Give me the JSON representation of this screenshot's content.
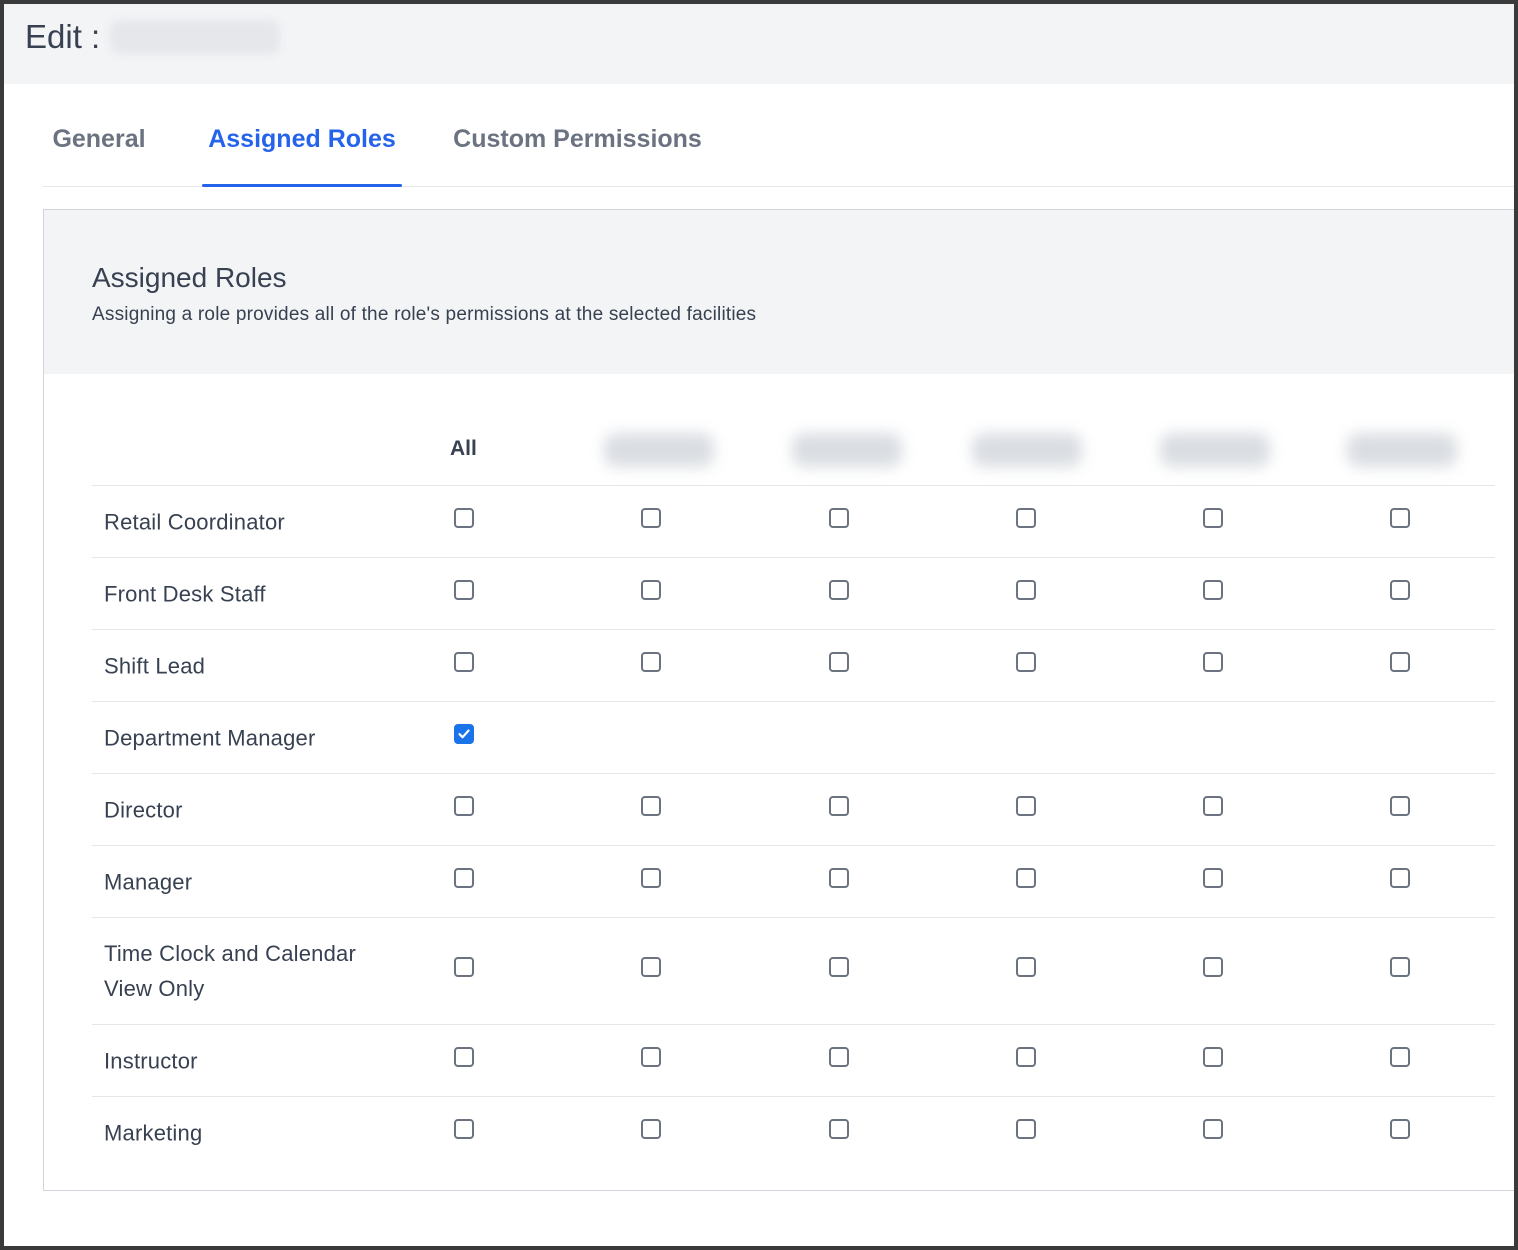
{
  "header": {
    "title": "Edit :"
  },
  "tabs": [
    {
      "label": "General",
      "active": false
    },
    {
      "label": "Assigned Roles",
      "active": true
    },
    {
      "label": "Custom Permissions",
      "active": false
    }
  ],
  "panel": {
    "title": "Assigned Roles",
    "subtitle": "Assigning a role provides all of the role's permissions at the selected facilities"
  },
  "table": {
    "all_label": "All",
    "facility_count": 5,
    "rows": [
      {
        "name": "Retail Coordinator",
        "all": false,
        "show_facilities": true,
        "facilities": [
          false,
          false,
          false,
          false,
          false
        ]
      },
      {
        "name": "Front Desk Staff",
        "all": false,
        "show_facilities": true,
        "facilities": [
          false,
          false,
          false,
          false,
          false
        ]
      },
      {
        "name": "Shift Lead",
        "all": false,
        "show_facilities": true,
        "facilities": [
          false,
          false,
          false,
          false,
          false
        ]
      },
      {
        "name": "Department Manager",
        "all": true,
        "show_facilities": false,
        "facilities": []
      },
      {
        "name": "Director",
        "all": false,
        "show_facilities": true,
        "facilities": [
          false,
          false,
          false,
          false,
          false
        ]
      },
      {
        "name": "Manager",
        "all": false,
        "show_facilities": true,
        "facilities": [
          false,
          false,
          false,
          false,
          false
        ]
      },
      {
        "name": "Time Clock and Calendar View Only",
        "all": false,
        "show_facilities": true,
        "facilities": [
          false,
          false,
          false,
          false,
          false
        ]
      },
      {
        "name": "Instructor",
        "all": false,
        "show_facilities": true,
        "facilities": [
          false,
          false,
          false,
          false,
          false
        ]
      },
      {
        "name": "Marketing",
        "all": false,
        "show_facilities": true,
        "facilities": [
          false,
          false,
          false,
          false,
          false
        ]
      }
    ]
  },
  "colors": {
    "accent": "#2563eb",
    "checkbox_checked": "#1a73e8"
  }
}
